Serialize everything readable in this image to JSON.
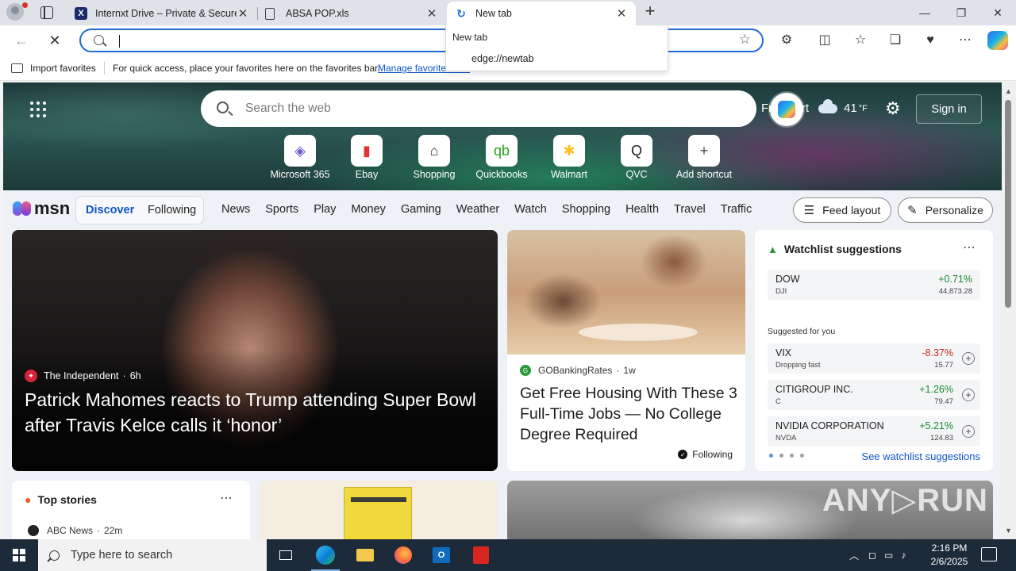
{
  "browser": {
    "tabs": [
      {
        "label": "Internxt Drive – Private & Secure",
        "icon": "internxt-logo"
      },
      {
        "label": "ABSA POP.xls",
        "icon": "document-icon"
      },
      {
        "label": "New tab",
        "icon": "loading-icon"
      }
    ],
    "close_glyph": "✕",
    "new_tab_glyph": "+",
    "window_controls": {
      "minimize": "—",
      "maximize": "❐",
      "close": "✕"
    },
    "address_value": "",
    "suggestion": {
      "heading": "New tab",
      "url": "edge://newtab"
    },
    "favorites_bar": {
      "import_label": "Import favorites",
      "message": "For quick access, place your favorites here on the favorites bar.",
      "manage_link": "Manage favorites now"
    }
  },
  "newtab": {
    "search_placeholder": "Search the web",
    "weather": {
      "city": "Frankfurt",
      "temp": "41",
      "unit": "°F"
    },
    "signin_label": "Sign in",
    "shortcuts": [
      {
        "label": "Microsoft 365",
        "glyph": "◈",
        "color": "#6e5ccf"
      },
      {
        "label": "Ebay",
        "glyph": "▮",
        "color": "#e53238"
      },
      {
        "label": "Shopping",
        "glyph": "⌂",
        "color": "#333333"
      },
      {
        "label": "Quickbooks",
        "glyph": "qb",
        "color": "#2ca01c"
      },
      {
        "label": "Walmart",
        "glyph": "✱",
        "color": "#ffc220"
      },
      {
        "label": "QVC",
        "glyph": "Q",
        "color": "#222222"
      },
      {
        "label": "Add shortcut",
        "glyph": "+",
        "color": "#444444"
      }
    ]
  },
  "msn": {
    "logo_text": "msn",
    "feed_tabs": [
      "Discover",
      "Following"
    ],
    "nav_links": [
      "News",
      "Sports",
      "Play",
      "Money",
      "Gaming",
      "Weather",
      "Watch",
      "Shopping",
      "Health",
      "Travel",
      "Traffic"
    ],
    "feed_layout_label": "Feed layout",
    "personalize_label": "Personalize"
  },
  "main_story": {
    "source": "The Independent",
    "age": "6h",
    "headline": "Patrick Mahomes reacts to Trump attending Super Bowl after Travis Kelce calls it ‘honor’"
  },
  "mid_story": {
    "source": "GOBankingRates",
    "age": "1w",
    "headline": "Get Free Housing With These 3 Full-Time Jobs — No College Degree Required",
    "follow_label": "Following"
  },
  "watchlist": {
    "title": "Watchlist suggestions",
    "suggested_label": "Suggested for you",
    "see_more": "See watchlist suggestions",
    "top": {
      "name": "DOW",
      "symbol": "DJI",
      "change": "+0.71%",
      "price": "44,873.28",
      "direction": "up"
    },
    "items": [
      {
        "name": "VIX",
        "symbol": "Dropping fast",
        "change": "-8.37%",
        "price": "15.77",
        "direction": "down"
      },
      {
        "name": "CITIGROUP INC.",
        "symbol": "C",
        "change": "+1.26%",
        "price": "79.47",
        "direction": "up"
      },
      {
        "name": "NVIDIA CORPORATION",
        "symbol": "NVDA",
        "change": "+5.21%",
        "price": "124.83",
        "direction": "up"
      }
    ]
  },
  "top_stories": {
    "title": "Top stories",
    "source": "ABC News",
    "age": "22m"
  },
  "watermark": "ANY▷RUN",
  "taskbar": {
    "search_placeholder": "Type here to search",
    "time": "2:16 PM",
    "date": "2/6/2025"
  }
}
